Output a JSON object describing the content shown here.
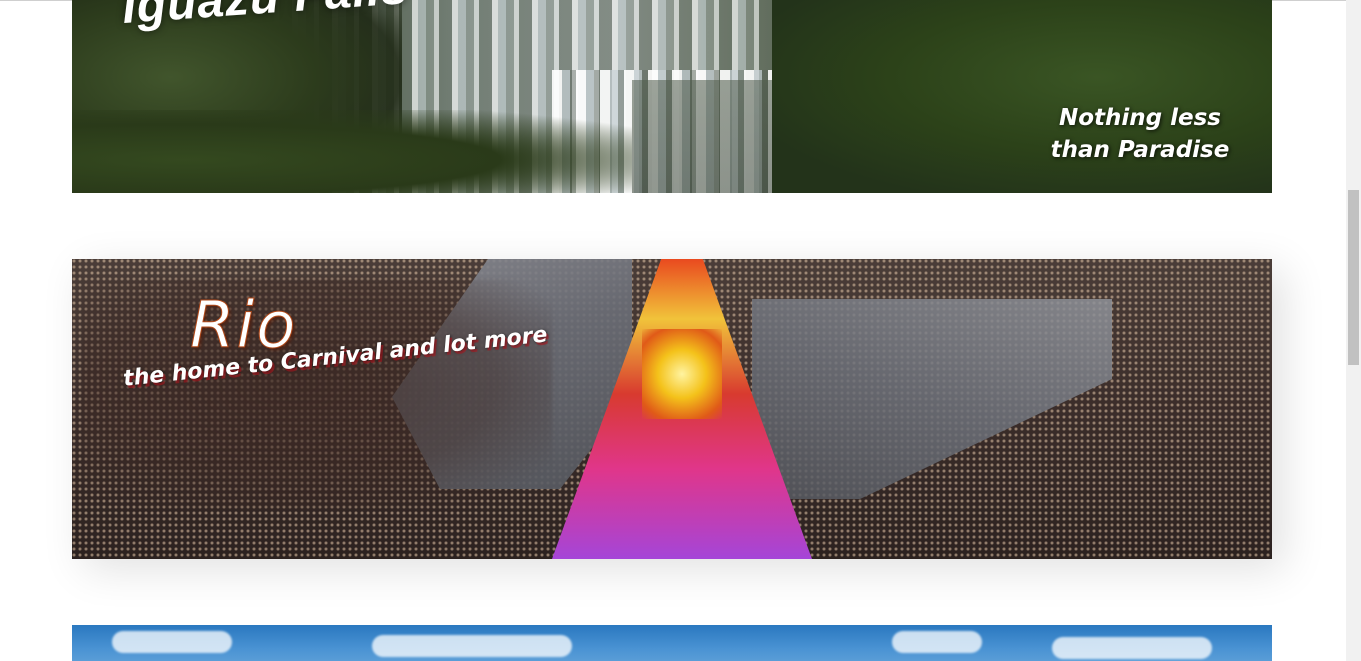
{
  "banners": [
    {
      "id": "iguazu",
      "title": "Iguazu Falls",
      "tagline": "Nothing less than Paradise"
    },
    {
      "id": "rio",
      "title": "Rio",
      "subtitle": "the home to Carnival and lot more"
    },
    {
      "id": "next",
      "title": ""
    }
  ],
  "colors": {
    "page_background": "#ffffff",
    "sky_blue": "#4a93d3",
    "rio_title_stroke": "#b24a1a",
    "scrollbar_thumb": "#c1c1c1"
  }
}
